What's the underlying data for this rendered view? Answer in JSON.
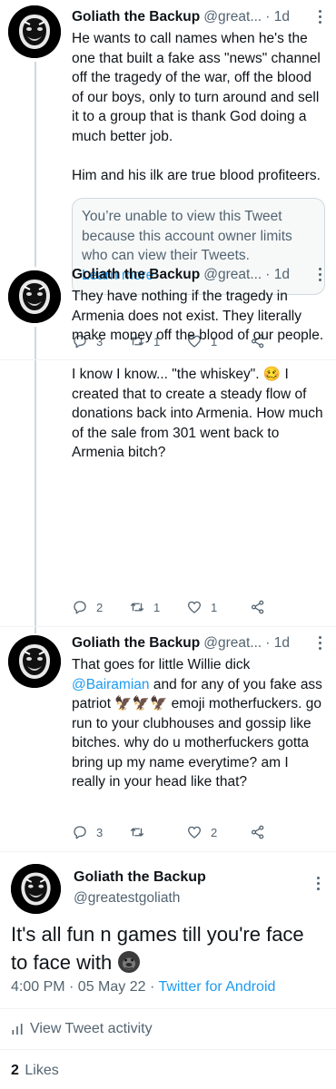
{
  "replies": [
    {
      "name": "Goliath the Backup",
      "handle": "@great...",
      "sep": "·",
      "time": "1d",
      "text": "He wants to call names when he's the one that built a fake ass \"news\" channel off the tragedy of the war, off the blood of our boys, only to turn around and sell it to a group that is thank God doing a much better job.\n\nHim and his ilk are true blood profiteers.",
      "quote": {
        "text": "You’re unable to view this Tweet because this account owner limits who can view their Tweets.",
        "link": "Learn more"
      },
      "replies_count": "3",
      "retweets_count": "1",
      "likes_count": "1"
    },
    {
      "name": "Goliath the Backup",
      "handle": "@great...",
      "sep": "·",
      "time": "1d",
      "text": "They have nothing if the tragedy in Armenia does not exist. They literally make money off the blood of our people.\n\nI know I know... \"the whiskey\". 🥴 I created that to create a steady flow of donations back into Armenia. How much of the sale from 301 went back to Armenia bitch?",
      "replies_count": "2",
      "retweets_count": "1",
      "likes_count": "1"
    },
    {
      "name": "Goliath the Backup",
      "handle": "@great...",
      "sep": "·",
      "time": "1d",
      "text_a": "That goes for little Willie dick",
      "mention": "@Bairamian",
      "text_b": " and for any of you fake ass patriot 🦅🦅🦅 emoji motherfuckers. go run to your clubhouses and gossip like bitches. why do u motherfuckers gotta bring up my name everytime? am I really in your head like that?",
      "replies_count": "3",
      "retweets_count": "",
      "likes_count": "2"
    }
  ],
  "main_tweet": {
    "name": "Goliath the Backup",
    "handle": "@greatestgoliath",
    "text": "It's all fun n games till you're face to face with",
    "emoji": "gorilla",
    "timestamp": "4:00 PM · 05 May 22 · ",
    "source": "Twitter for Android",
    "activity_label": "View Tweet activity",
    "likes_count": "2",
    "likes_label": "Likes"
  },
  "icons": [
    "reply-icon",
    "retweet-icon",
    "like-icon",
    "share-icon",
    "more-icon",
    "activity-icon"
  ],
  "colors": {
    "link": "#1d9bf0",
    "secondary": "#536471",
    "text": "#0f1419",
    "border": "#cfd9de"
  }
}
